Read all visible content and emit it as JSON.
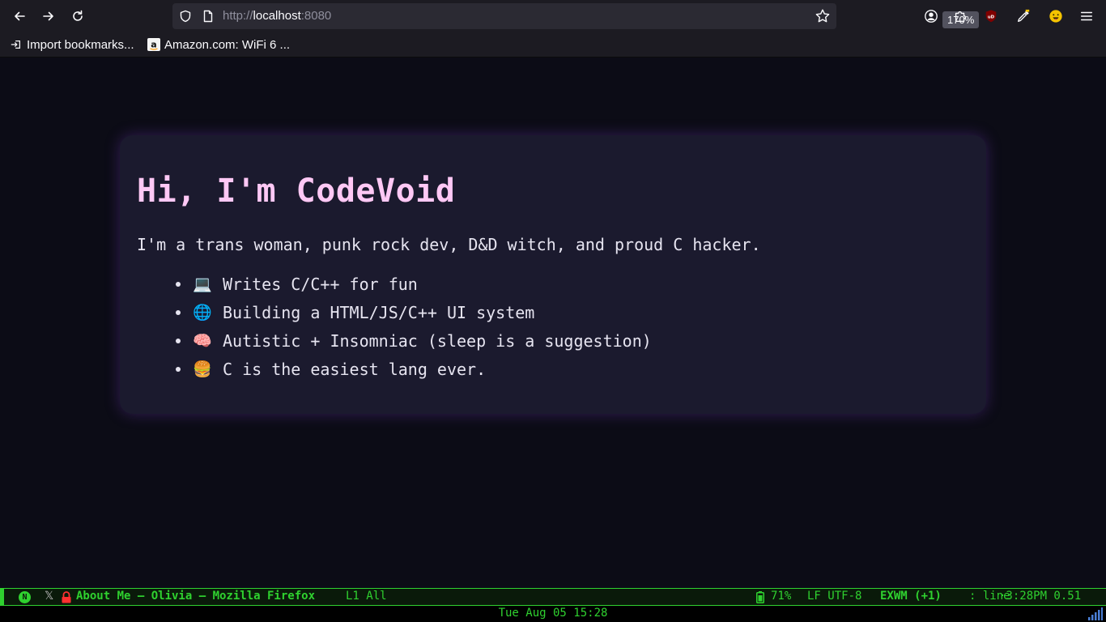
{
  "browser": {
    "url_scheme": "http://",
    "url_host": "localhost",
    "url_port": ":8080",
    "zoom": "170%"
  },
  "bookmarks": [
    {
      "label": "Import bookmarks...",
      "icon": "import-icon"
    },
    {
      "label": "Amazon.com: WiFi 6 ...",
      "icon": "amazon-icon"
    }
  ],
  "page": {
    "heading": "Hi, I'm CodeVoid",
    "intro": "I'm a trans woman, punk rock dev, D&D witch, and proud C hacker.",
    "bullets": [
      {
        "emoji": "💻",
        "text": "Writes C/C++ for fun"
      },
      {
        "emoji": "🌐",
        "text": "Building a HTML/JS/C++ UI system"
      },
      {
        "emoji": "🧠",
        "text": "Autistic + Insomniac (sleep is a suggestion)"
      },
      {
        "emoji": "🍔",
        "text": "C is the easiest lang ever."
      }
    ],
    "colors": {
      "heading": "#ffc8f5",
      "card": "#1b1a2e",
      "background": "#0c0c16"
    }
  },
  "modeline": {
    "n_badge": "N",
    "window_title": "About Me — Olivia — Mozilla Firefox",
    "position": "L1 All",
    "battery": "71%",
    "encoding": "LF UTF-8",
    "mode": "EXWM (+1)",
    "line": ": line",
    "time": "·3:28PM 0.51",
    "accent_color": "#2fd12f"
  },
  "echo": {
    "clock": "Tue Aug 05 15:28"
  }
}
